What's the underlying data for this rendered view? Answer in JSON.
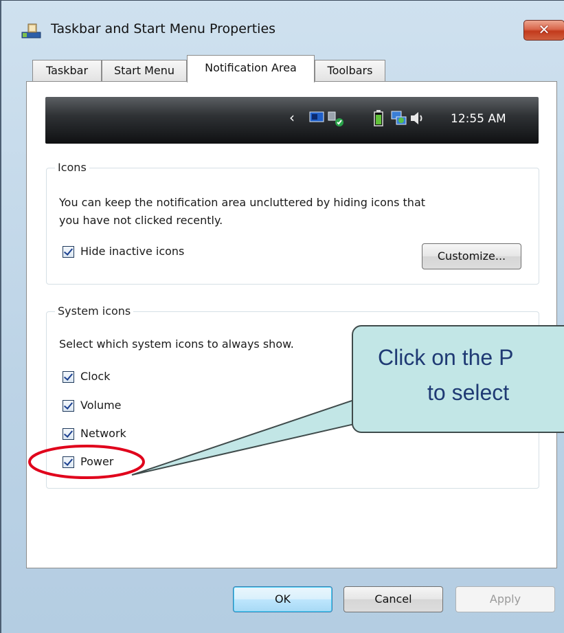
{
  "window": {
    "title": "Taskbar and Start Menu Properties",
    "close_glyph": "✕"
  },
  "tabs": [
    {
      "label": "Taskbar"
    },
    {
      "label": "Start Menu"
    },
    {
      "label": "Notification Area",
      "active": true
    },
    {
      "label": "Toolbars"
    }
  ],
  "preview": {
    "chevron": "‹",
    "clock": "12:55 AM",
    "icons": [
      "monitor-icon",
      "network-check-icon",
      "battery-icon",
      "network-icon",
      "speaker-icon"
    ]
  },
  "icons_group": {
    "legend": "Icons",
    "description_line1": "You can keep the notification area uncluttered by hiding icons that",
    "description_line2": "you have not clicked recently.",
    "hide_inactive_label": "Hide inactive icons",
    "hide_inactive_checked": true,
    "customize_label": "Customize..."
  },
  "system_icons_group": {
    "legend": "System icons",
    "description": "Select which system icons to always show.",
    "items": [
      {
        "label": "Clock",
        "checked": true
      },
      {
        "label": "Volume",
        "checked": true
      },
      {
        "label": "Network",
        "checked": true
      },
      {
        "label": "Power",
        "checked": true
      }
    ]
  },
  "buttons": {
    "ok": "OK",
    "cancel": "Cancel",
    "apply": "Apply"
  },
  "callout": {
    "line1": "Click on the P",
    "line2": "to select"
  },
  "colors": {
    "callout_fill": "#c2e6e6",
    "highlight_ring": "#e0001b",
    "callout_text": "#1f3a74"
  }
}
